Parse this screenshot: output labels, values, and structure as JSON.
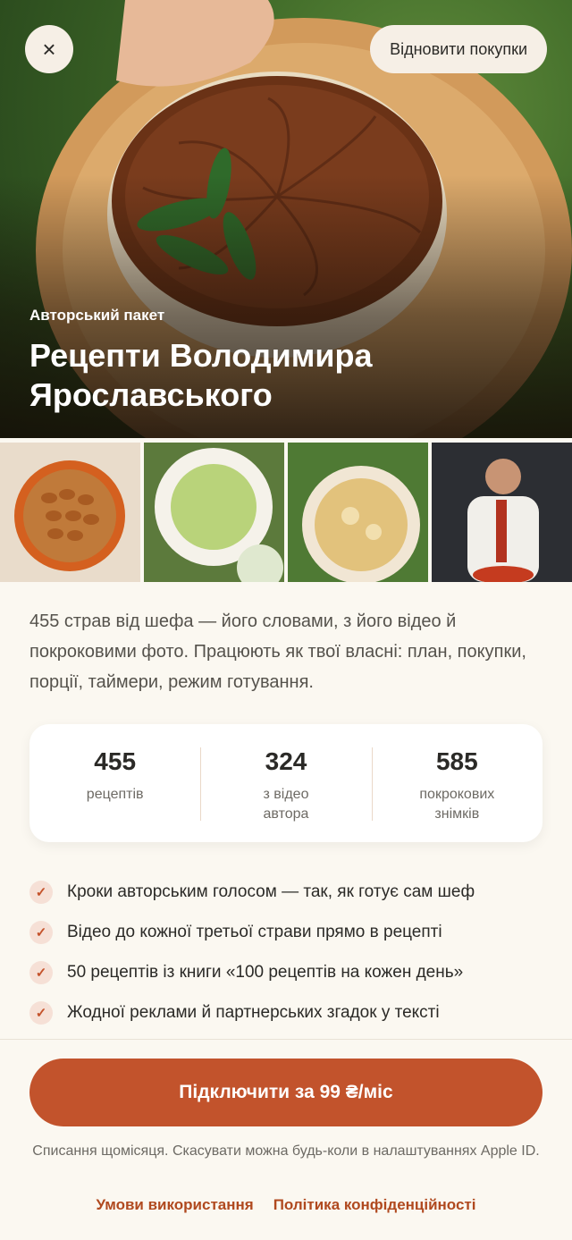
{
  "header": {
    "close_icon": "close-icon",
    "close_glyph": "×",
    "restore_label": "Відновити покупки"
  },
  "hero": {
    "kicker": "Авторський пакет",
    "title": "Рецепти Володимира Ярославського"
  },
  "gallery": [
    "almond-cookies-photo",
    "green-soup-photo",
    "flatbread-photo",
    "chef-portrait-photo"
  ],
  "description": "455 страв від шефа — його словами, з його відео й покроковими фото. Працюють як твої власні: план, покупки, порції, таймери, режим готування.",
  "stats": [
    {
      "value": "455",
      "label": "рецептів"
    },
    {
      "value": "324",
      "label": "з відео автора"
    },
    {
      "value": "585",
      "label": "покрокових знімків"
    }
  ],
  "features": [
    "Кроки авторським голосом — так, як готує сам шеф",
    "Відео до кожної третьої страви прямо в рецепті",
    "50 рецептів із книги «100 рецептів на кожен день»",
    "Жодної реклами й партнерських згадок у тексті"
  ],
  "check_glyph": "✓",
  "cta_label": "Підключити за 99 ₴/міс",
  "billing_note": "Списання щомісяця. Скасувати можна будь-коли в налаштуваннях Apple ID.",
  "links": {
    "terms": "Умови використання",
    "privacy": "Політика конфіденційності"
  },
  "colors": {
    "accent": "#c2532c",
    "link": "#b0491f",
    "background": "#fbf8f1"
  }
}
